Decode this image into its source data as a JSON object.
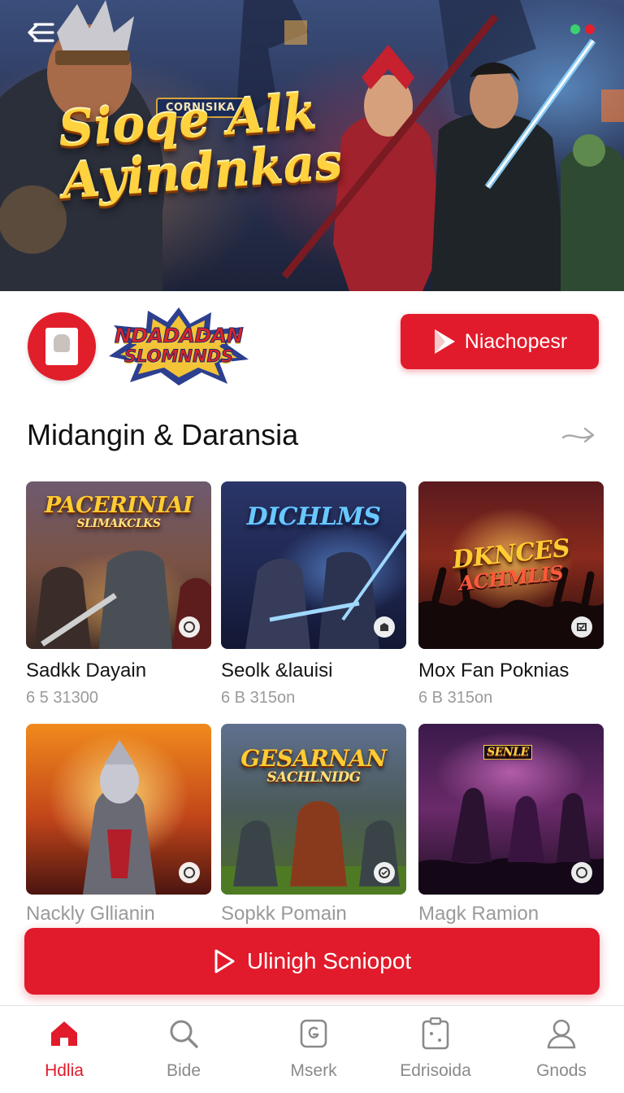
{
  "hero": {
    "badge": "CORNISIKA",
    "title_line1": "Sioqe Alk",
    "title_line2": "Ayindnkas",
    "dot_colors": [
      "#3bd16f",
      "#e5202e"
    ]
  },
  "app": {
    "logo_line1": "NDADADAN",
    "logo_line2": "SLOMNNDS",
    "install_label": "Niachopesr"
  },
  "section": {
    "title": "Midangin  & Daransia",
    "cards": [
      {
        "thumb_title": "PACERINIAI",
        "thumb_sub": "SLIMAKCLKS",
        "name": "Sadkk Dayain",
        "meta": "6 5 31300"
      },
      {
        "thumb_title": "DICHLMS",
        "thumb_sub": "",
        "name": "Seolk &lauisi",
        "meta": "6 B 315on"
      },
      {
        "thumb_title": "DKNCES",
        "thumb_sub": "ACHMLIS",
        "name": "Mox Fan Poknias",
        "meta": "6 B 315on"
      },
      {
        "thumb_title": "",
        "thumb_sub": "",
        "name": "Nackly Gllianin",
        "meta": ""
      },
      {
        "thumb_title": "GESARNAN",
        "thumb_sub": "SACHLNIDG",
        "name": "Sopkk Pomain",
        "meta": ""
      },
      {
        "thumb_title": "SENLE",
        "thumb_sub": "",
        "name": "Magk Ramion",
        "meta": ""
      }
    ]
  },
  "cta": {
    "label": "Ulinigh Scniopot"
  },
  "nav": {
    "items": [
      {
        "label": "Hdlia",
        "icon": "home-icon",
        "active": true
      },
      {
        "label": "Bide",
        "icon": "search-icon",
        "active": false
      },
      {
        "label": "Mserk",
        "icon": "note-icon",
        "active": false
      },
      {
        "label": "Edrisoida",
        "icon": "clipboard-icon",
        "active": false
      },
      {
        "label": "Gnods",
        "icon": "profile-icon",
        "active": false
      }
    ]
  },
  "colors": {
    "accent": "#e11b2b",
    "muted": "#8a8a8a"
  }
}
